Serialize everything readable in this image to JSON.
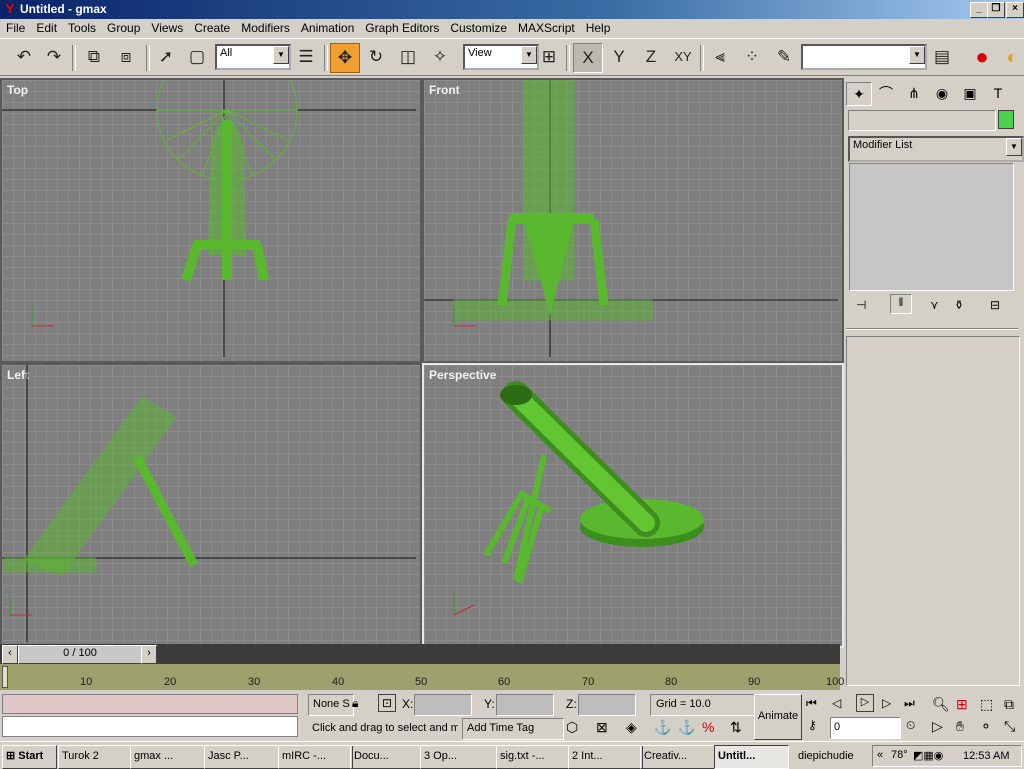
{
  "window": {
    "title": "Untitled - gmax",
    "min_label": "_",
    "max_label": "❐",
    "close_label": "×"
  },
  "menu": [
    "File",
    "Edit",
    "Tools",
    "Group",
    "Views",
    "Create",
    "Modifiers",
    "Animation",
    "Graph Editors",
    "Customize",
    "MAXScript",
    "Help"
  ],
  "toolbar": {
    "selection_filter": "All",
    "coord_system": "View",
    "named_selection": "",
    "axis_x": "X",
    "axis_y": "Y",
    "axis_z": "Z",
    "axis_xy": "XY"
  },
  "viewports": {
    "top": "Top",
    "front": "Front",
    "left": "Left",
    "perspective": "Perspective"
  },
  "command_panel": {
    "object_name": "",
    "object_color": "#4ad24a",
    "modifier_list": "Modifier List"
  },
  "timeline": {
    "frame": "0 / 100",
    "ticks": [
      "10",
      "20",
      "30",
      "40",
      "50",
      "60",
      "70",
      "80",
      "90",
      "100"
    ]
  },
  "status": {
    "selection": "None S",
    "lock_icon": "lock-icon",
    "x_label": "X:",
    "y_label": "Y:",
    "z_label": "Z:",
    "grid": "Grid = 10.0",
    "prompt": "Click and drag to select and m",
    "add_time_tag": "Add Time Tag",
    "animate": "Animate",
    "frame_field": "0"
  },
  "taskbar": {
    "start": "Start",
    "items": [
      "Turok 2",
      "gmax ...",
      "Jasc P...",
      "mIRC -...",
      "Docu...",
      "3 Op...",
      "sig.txt -...",
      "2 Int...",
      "Creativ...",
      "Untitl..."
    ],
    "username": "diepichudie",
    "tray_temp": "78°",
    "clock": "12:53 AM"
  }
}
